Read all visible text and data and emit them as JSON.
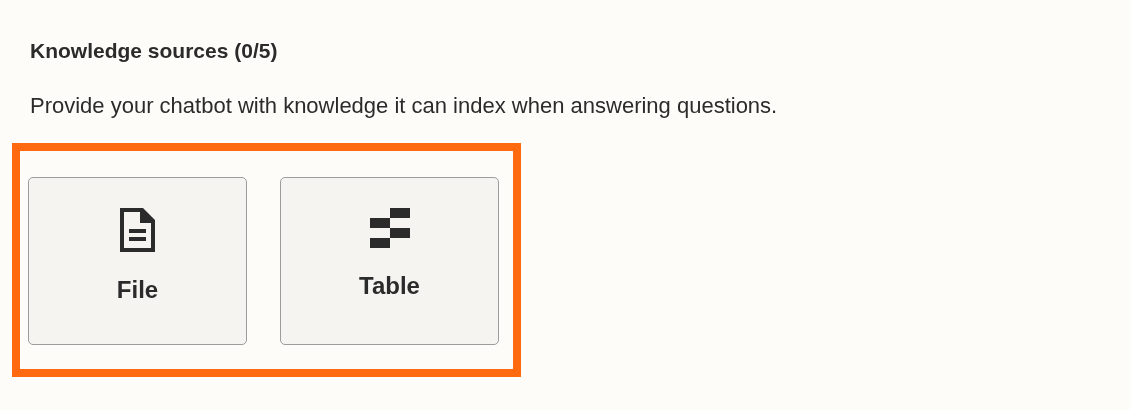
{
  "heading": "Knowledge sources (0/5)",
  "description": "Provide your chatbot with knowledge it can index when answering questions.",
  "sources": [
    {
      "kind": "file",
      "label": "File"
    },
    {
      "kind": "table",
      "label": "Table"
    }
  ]
}
